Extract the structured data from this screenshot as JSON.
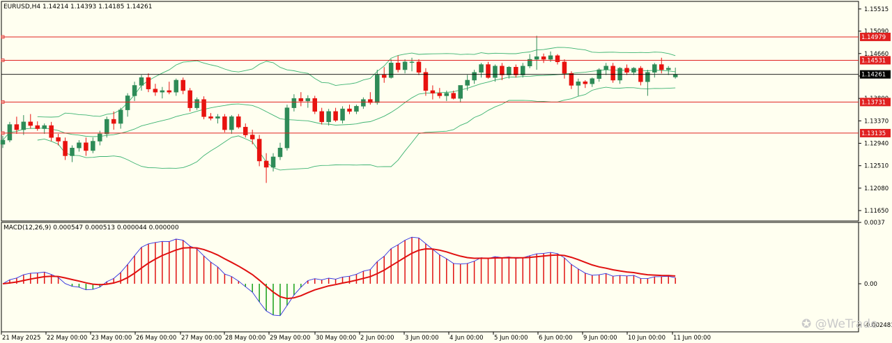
{
  "chart_data": [
    {
      "type": "candlestick",
      "title": "EURUSD,H4  1.14214 1.14393 1.14185 1.14261",
      "ylim": [
        1.1145,
        1.1566
      ],
      "y_ticks": [
        "1.15515",
        "1.15090",
        "1.14660",
        "1.14230",
        "1.13800",
        "1.13370",
        "1.12940",
        "1.12510",
        "1.12080",
        "1.11650"
      ],
      "x_ticks": [
        "21 May 2025",
        "22 May 00:00",
        "23 May 00:00",
        "26 May 00:00",
        "27 May 00:00",
        "28 May 00:00",
        "29 May 00:00",
        "30 May 00:00",
        "2 Jun 00:00",
        "3 Jun 00:00",
        "4 Jun 00:00",
        "5 Jun 00:00",
        "6 Jun 00:00",
        "9 Jun 00:00",
        "10 Jun 00:00",
        "11 Jun 00:00"
      ],
      "current_price": "1.14261",
      "levels": [
        "1.14979",
        "1.14531",
        "1.13731",
        "1.13135"
      ],
      "candles": [
        [
          1.1292,
          1.1308,
          1.1285,
          1.13
        ],
        [
          1.13,
          1.1335,
          1.1296,
          1.133
        ],
        [
          1.133,
          1.1345,
          1.1312,
          1.132
        ],
        [
          1.132,
          1.1348,
          1.131,
          1.1335
        ],
        [
          1.1335,
          1.135,
          1.1322,
          1.1328
        ],
        [
          1.1328,
          1.1336,
          1.1318,
          1.1322
        ],
        [
          1.1322,
          1.1332,
          1.1312,
          1.1328
        ],
        [
          1.1328,
          1.1335,
          1.1298,
          1.1305
        ],
        [
          1.1305,
          1.1312,
          1.129,
          1.1298
        ],
        [
          1.1298,
          1.1305,
          1.1262,
          1.127
        ],
        [
          1.127,
          1.129,
          1.1258,
          1.1285
        ],
        [
          1.1285,
          1.13,
          1.1278,
          1.1295
        ],
        [
          1.1295,
          1.1305,
          1.127,
          1.128
        ],
        [
          1.128,
          1.1305,
          1.1275,
          1.1298
        ],
        [
          1.1298,
          1.1318,
          1.129,
          1.1312
        ],
        [
          1.1312,
          1.1345,
          1.1305,
          1.134
        ],
        [
          1.134,
          1.1355,
          1.132,
          1.1332
        ],
        [
          1.1332,
          1.1362,
          1.1322,
          1.1358
        ],
        [
          1.1358,
          1.139,
          1.1345,
          1.1385
        ],
        [
          1.1385,
          1.1412,
          1.1375,
          1.1405
        ],
        [
          1.1405,
          1.1425,
          1.1395,
          1.142
        ],
        [
          1.142,
          1.1428,
          1.1392,
          1.1398
        ],
        [
          1.1398,
          1.1408,
          1.1385,
          1.1392
        ],
        [
          1.1392,
          1.1402,
          1.138,
          1.1395
        ],
        [
          1.1395,
          1.1412,
          1.1388,
          1.1392
        ],
        [
          1.1392,
          1.1418,
          1.1385,
          1.1415
        ],
        [
          1.1415,
          1.142,
          1.1388,
          1.1395
        ],
        [
          1.1395,
          1.14,
          1.1355,
          1.1362
        ],
        [
          1.1362,
          1.1382,
          1.1358,
          1.1378
        ],
        [
          1.1378,
          1.1384,
          1.134,
          1.1345
        ],
        [
          1.1345,
          1.1352,
          1.1338,
          1.1342
        ],
        [
          1.1342,
          1.135,
          1.1332,
          1.1345
        ],
        [
          1.1345,
          1.135,
          1.1315,
          1.132
        ],
        [
          1.132,
          1.1348,
          1.1312,
          1.1345
        ],
        [
          1.1345,
          1.135,
          1.1322,
          1.1325
        ],
        [
          1.1325,
          1.1332,
          1.1305,
          1.131
        ],
        [
          1.131,
          1.132,
          1.1292,
          1.1302
        ],
        [
          1.1302,
          1.131,
          1.125,
          1.126
        ],
        [
          1.126,
          1.1275,
          1.1218,
          1.1248
        ],
        [
          1.1248,
          1.1275,
          1.124,
          1.1268
        ],
        [
          1.1268,
          1.1295,
          1.1262,
          1.1285
        ],
        [
          1.1285,
          1.1368,
          1.128,
          1.1362
        ],
        [
          1.1362,
          1.1388,
          1.1355,
          1.138
        ],
        [
          1.138,
          1.1392,
          1.1365,
          1.1375
        ],
        [
          1.1375,
          1.1386,
          1.1362,
          1.138
        ],
        [
          1.138,
          1.1385,
          1.135,
          1.1355
        ],
        [
          1.1355,
          1.1362,
          1.133,
          1.1335
        ],
        [
          1.1335,
          1.136,
          1.1328,
          1.1355
        ],
        [
          1.1355,
          1.1362,
          1.1335,
          1.1338
        ],
        [
          1.1338,
          1.1365,
          1.1332,
          1.136
        ],
        [
          1.136,
          1.1368,
          1.135,
          1.1355
        ],
        [
          1.1355,
          1.1368,
          1.135,
          1.1365
        ],
        [
          1.1365,
          1.1382,
          1.136,
          1.1378
        ],
        [
          1.1378,
          1.1392,
          1.1368,
          1.1372
        ],
        [
          1.1372,
          1.1435,
          1.1368,
          1.1425
        ],
        [
          1.1425,
          1.144,
          1.141,
          1.142
        ],
        [
          1.142,
          1.1455,
          1.1418,
          1.1448
        ],
        [
          1.1448,
          1.1462,
          1.143,
          1.1435
        ],
        [
          1.1435,
          1.1455,
          1.1428,
          1.145
        ],
        [
          1.145,
          1.1458,
          1.1432,
          1.145
        ],
        [
          1.145,
          1.1455,
          1.1425,
          1.143
        ],
        [
          1.143,
          1.1438,
          1.1385,
          1.1395
        ],
        [
          1.1395,
          1.1405,
          1.1378,
          1.139
        ],
        [
          1.139,
          1.14,
          1.138,
          1.1385
        ],
        [
          1.1385,
          1.1395,
          1.1375,
          1.139
        ],
        [
          1.139,
          1.1395,
          1.1378,
          1.138
        ],
        [
          1.138,
          1.1405,
          1.1372,
          1.1405
        ],
        [
          1.1405,
          1.1425,
          1.1395,
          1.1415
        ],
        [
          1.1415,
          1.1435,
          1.1408,
          1.143
        ],
        [
          1.143,
          1.1448,
          1.142,
          1.1445
        ],
        [
          1.1445,
          1.145,
          1.1418,
          1.142
        ],
        [
          1.142,
          1.1445,
          1.1412,
          1.1442
        ],
        [
          1.1442,
          1.1448,
          1.1415,
          1.1425
        ],
        [
          1.1425,
          1.1442,
          1.1418,
          1.144
        ],
        [
          1.144,
          1.1445,
          1.142,
          1.1425
        ],
        [
          1.1425,
          1.1448,
          1.142,
          1.1442
        ],
        [
          1.1442,
          1.1465,
          1.1438,
          1.1455
        ],
        [
          1.1455,
          1.15,
          1.1435,
          1.146
        ],
        [
          1.146,
          1.1466,
          1.1448,
          1.1455
        ],
        [
          1.1455,
          1.147,
          1.145,
          1.1462
        ],
        [
          1.1462,
          1.1465,
          1.1445,
          1.145
        ],
        [
          1.145,
          1.1455,
          1.1418,
          1.1428
        ],
        [
          1.1428,
          1.1432,
          1.1398,
          1.1405
        ],
        [
          1.1405,
          1.1418,
          1.1385,
          1.1412
        ],
        [
          1.1412,
          1.1415,
          1.14,
          1.1408
        ],
        [
          1.1408,
          1.142,
          1.1402,
          1.1418
        ],
        [
          1.1418,
          1.1438,
          1.1412,
          1.1435
        ],
        [
          1.1435,
          1.1448,
          1.1425,
          1.1442
        ],
        [
          1.1442,
          1.1448,
          1.141,
          1.1415
        ],
        [
          1.1415,
          1.144,
          1.1408,
          1.1438
        ],
        [
          1.1438,
          1.1445,
          1.1425,
          1.143
        ],
        [
          1.143,
          1.144,
          1.1425,
          1.1438
        ],
        [
          1.1438,
          1.1442,
          1.1405,
          1.1412
        ],
        [
          1.1412,
          1.1435,
          1.1385,
          1.143
        ],
        [
          1.143,
          1.1448,
          1.142,
          1.1445
        ],
        [
          1.1445,
          1.1458,
          1.1428,
          1.1435
        ],
        [
          1.1435,
          1.1442,
          1.1425,
          1.1438
        ],
        [
          1.1421,
          1.1439,
          1.1418,
          1.1426
        ]
      ]
    },
    {
      "type": "line",
      "title": "MACD(12,26,9) 0.000547 0.000513 0.000044 0.000000",
      "ylim": [
        -0.0029,
        0.0037
      ],
      "y_ticks": [
        "0.0037",
        "0.00",
        "-0.002481"
      ]
    }
  ],
  "watermark": "WeTrade",
  "colors": {
    "bull": "#2e8b57",
    "bear": "#e8120f",
    "bg": "#fffff0",
    "level": "#e02020",
    "band": "#3cb371",
    "macd_main": "#3030e0",
    "macd_signal": "#e01010"
  }
}
